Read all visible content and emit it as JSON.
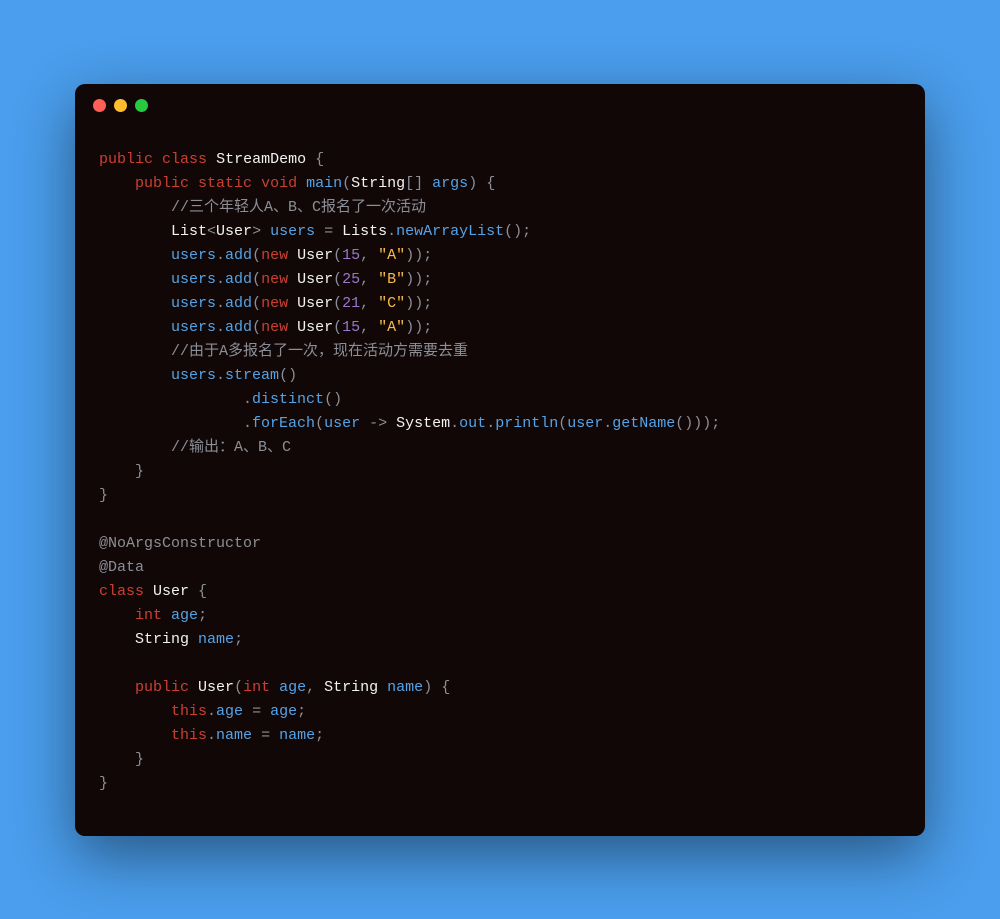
{
  "window": {
    "controls": [
      "close",
      "minimize",
      "zoom"
    ]
  },
  "code": {
    "language": "java",
    "tokens": [
      [
        [
          "k",
          "public"
        ],
        [
          "p",
          " "
        ],
        [
          "k",
          "class"
        ],
        [
          "p",
          " "
        ],
        [
          "t",
          "StreamDemo"
        ],
        [
          "p",
          " {"
        ]
      ],
      [
        [
          "p",
          "    "
        ],
        [
          "k",
          "public"
        ],
        [
          "p",
          " "
        ],
        [
          "k",
          "static"
        ],
        [
          "p",
          " "
        ],
        [
          "k",
          "void"
        ],
        [
          "p",
          " "
        ],
        [
          "fn",
          "main"
        ],
        [
          "p",
          "("
        ],
        [
          "t",
          "String"
        ],
        [
          "p",
          "[] "
        ],
        [
          "v",
          "args"
        ],
        [
          "p",
          ") {"
        ]
      ],
      [
        [
          "p",
          "        "
        ],
        [
          "c",
          "//三个年轻人A、B、C报名了一次活动"
        ]
      ],
      [
        [
          "p",
          "        "
        ],
        [
          "t",
          "List"
        ],
        [
          "p",
          "<"
        ],
        [
          "t",
          "User"
        ],
        [
          "p",
          "> "
        ],
        [
          "v",
          "users"
        ],
        [
          "p",
          " = "
        ],
        [
          "t",
          "Lists"
        ],
        [
          "dot2",
          "."
        ],
        [
          "fn",
          "newArrayList"
        ],
        [
          "p",
          "();"
        ]
      ],
      [
        [
          "p",
          "        "
        ],
        [
          "v",
          "users"
        ],
        [
          "dot2",
          "."
        ],
        [
          "fn",
          "add"
        ],
        [
          "p",
          "("
        ],
        [
          "k",
          "new"
        ],
        [
          "p",
          " "
        ],
        [
          "t",
          "User"
        ],
        [
          "p",
          "("
        ],
        [
          "n",
          "15"
        ],
        [
          "p",
          ", "
        ],
        [
          "s",
          "\"A\""
        ],
        [
          "p",
          "));"
        ]
      ],
      [
        [
          "p",
          "        "
        ],
        [
          "v",
          "users"
        ],
        [
          "dot2",
          "."
        ],
        [
          "fn",
          "add"
        ],
        [
          "p",
          "("
        ],
        [
          "k",
          "new"
        ],
        [
          "p",
          " "
        ],
        [
          "t",
          "User"
        ],
        [
          "p",
          "("
        ],
        [
          "n",
          "25"
        ],
        [
          "p",
          ", "
        ],
        [
          "s",
          "\"B\""
        ],
        [
          "p",
          "));"
        ]
      ],
      [
        [
          "p",
          "        "
        ],
        [
          "v",
          "users"
        ],
        [
          "dot2",
          "."
        ],
        [
          "fn",
          "add"
        ],
        [
          "p",
          "("
        ],
        [
          "k",
          "new"
        ],
        [
          "p",
          " "
        ],
        [
          "t",
          "User"
        ],
        [
          "p",
          "("
        ],
        [
          "n",
          "21"
        ],
        [
          "p",
          ", "
        ],
        [
          "s",
          "\"C\""
        ],
        [
          "p",
          "));"
        ]
      ],
      [
        [
          "p",
          "        "
        ],
        [
          "v",
          "users"
        ],
        [
          "dot2",
          "."
        ],
        [
          "fn",
          "add"
        ],
        [
          "p",
          "("
        ],
        [
          "k",
          "new"
        ],
        [
          "p",
          " "
        ],
        [
          "t",
          "User"
        ],
        [
          "p",
          "("
        ],
        [
          "n",
          "15"
        ],
        [
          "p",
          ", "
        ],
        [
          "s",
          "\"A\""
        ],
        [
          "p",
          "));"
        ]
      ],
      [
        [
          "p",
          "        "
        ],
        [
          "c",
          "//由于A多报名了一次，现在活动方需要去重"
        ]
      ],
      [
        [
          "p",
          "        "
        ],
        [
          "v",
          "users"
        ],
        [
          "dot2",
          "."
        ],
        [
          "fn",
          "stream"
        ],
        [
          "p",
          "()"
        ]
      ],
      [
        [
          "p",
          "                "
        ],
        [
          "dot2",
          "."
        ],
        [
          "fn",
          "distinct"
        ],
        [
          "p",
          "()"
        ]
      ],
      [
        [
          "p",
          "                "
        ],
        [
          "dot2",
          "."
        ],
        [
          "fn",
          "forEach"
        ],
        [
          "p",
          "("
        ],
        [
          "v",
          "user"
        ],
        [
          "p",
          " "
        ],
        [
          "op",
          "->"
        ],
        [
          "p",
          " "
        ],
        [
          "t",
          "System"
        ],
        [
          "dot2",
          "."
        ],
        [
          "v",
          "out"
        ],
        [
          "dot2",
          "."
        ],
        [
          "fn",
          "println"
        ],
        [
          "p",
          "("
        ],
        [
          "v",
          "user"
        ],
        [
          "dot2",
          "."
        ],
        [
          "fn",
          "getName"
        ],
        [
          "p",
          "()));"
        ]
      ],
      [
        [
          "p",
          "        "
        ],
        [
          "c",
          "//输出：A、B、C"
        ]
      ],
      [
        [
          "p",
          "    }"
        ]
      ],
      [
        [
          "p",
          "}"
        ]
      ],
      [
        [
          "p",
          ""
        ]
      ],
      [
        [
          "an",
          "@NoArgsConstructor"
        ]
      ],
      [
        [
          "an",
          "@Data"
        ]
      ],
      [
        [
          "k",
          "class"
        ],
        [
          "p",
          " "
        ],
        [
          "t",
          "User"
        ],
        [
          "p",
          " {"
        ]
      ],
      [
        [
          "p",
          "    "
        ],
        [
          "k",
          "int"
        ],
        [
          "p",
          " "
        ],
        [
          "v",
          "age"
        ],
        [
          "p",
          ";"
        ]
      ],
      [
        [
          "p",
          "    "
        ],
        [
          "t",
          "String"
        ],
        [
          "p",
          " "
        ],
        [
          "v",
          "name"
        ],
        [
          "p",
          ";"
        ]
      ],
      [
        [
          "p",
          ""
        ]
      ],
      [
        [
          "p",
          "    "
        ],
        [
          "k",
          "public"
        ],
        [
          "p",
          " "
        ],
        [
          "t",
          "User"
        ],
        [
          "p",
          "("
        ],
        [
          "k",
          "int"
        ],
        [
          "p",
          " "
        ],
        [
          "v",
          "age"
        ],
        [
          "p",
          ", "
        ],
        [
          "t",
          "String"
        ],
        [
          "p",
          " "
        ],
        [
          "v",
          "name"
        ],
        [
          "p",
          ") {"
        ]
      ],
      [
        [
          "p",
          "        "
        ],
        [
          "k",
          "this"
        ],
        [
          "dot2",
          "."
        ],
        [
          "v",
          "age"
        ],
        [
          "p",
          " = "
        ],
        [
          "v",
          "age"
        ],
        [
          "p",
          ";"
        ]
      ],
      [
        [
          "p",
          "        "
        ],
        [
          "k",
          "this"
        ],
        [
          "dot2",
          "."
        ],
        [
          "v",
          "name"
        ],
        [
          "p",
          " = "
        ],
        [
          "v",
          "name"
        ],
        [
          "p",
          ";"
        ]
      ],
      [
        [
          "p",
          "    }"
        ]
      ],
      [
        [
          "p",
          "}"
        ]
      ]
    ]
  }
}
